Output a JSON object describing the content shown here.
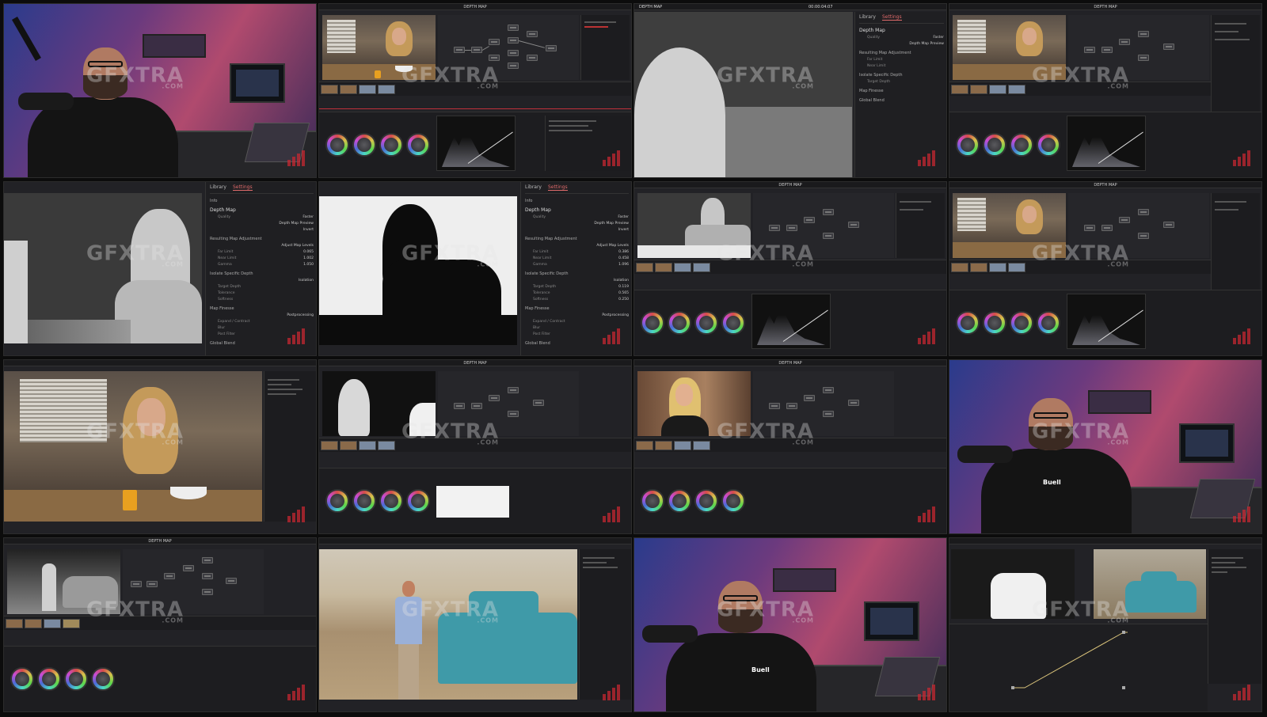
{
  "watermark": {
    "main": "GFXTRA",
    "sub": ".COM"
  },
  "tiles": [
    {
      "kind": "webcam"
    },
    {
      "kind": "resolve",
      "shot": "kitchen",
      "title": "DEPTH MAP"
    },
    {
      "kind": "depth-settings",
      "title": "DEPTH MAP",
      "timecode": "00:00:04:07",
      "tabs": [
        "Library",
        "Settings"
      ]
    },
    {
      "kind": "resolve",
      "shot": "kitchen",
      "title": "DEPTH MAP"
    },
    {
      "kind": "depth-settings-full",
      "shot": "depth-gray"
    },
    {
      "kind": "depth-settings-full",
      "shot": "depth-mask"
    },
    {
      "kind": "resolve",
      "shot": "depth-gray-small",
      "title": "DEPTH MAP"
    },
    {
      "kind": "resolve",
      "shot": "kitchen",
      "title": "DEPTH MAP"
    },
    {
      "kind": "big-viewer",
      "shot": "kitchen-large"
    },
    {
      "kind": "resolve",
      "shot": "depth-mask-small",
      "title": "DEPTH MAP"
    },
    {
      "kind": "resolve",
      "shot": "blonde",
      "title": "DEPTH MAP"
    },
    {
      "kind": "webcam"
    },
    {
      "kind": "resolve",
      "shot": "car-depth",
      "title": "DEPTH MAP"
    },
    {
      "kind": "big-viewer",
      "shot": "desert"
    },
    {
      "kind": "webcam"
    },
    {
      "kind": "fusion",
      "shot": "car-dual"
    }
  ],
  "settings": {
    "tabs": [
      "Library",
      "Settings"
    ],
    "section_label": "Info",
    "title": "Depth Map",
    "quality_label": "Quality",
    "quality_value": "Faster",
    "preview_label": "Depth Map Preview",
    "invert_label": "Invert",
    "adj_section": "Resulting Map Adjustment",
    "adjust_label": "Adjust Map Levels",
    "far_label": "Far Limit",
    "near_label": "Near Limit",
    "gamma_label": "Gamma",
    "isolate_section": "Isolate Specific Depth",
    "isolation_label": "Isolation",
    "target_label": "Target Depth",
    "tolerance_label": "Tolerance",
    "softness_label": "Softness",
    "finesse_section": "Map Finesse",
    "post_label": "Postprocessing",
    "expand_label": "Expand / Contract",
    "blur_label": "Blur",
    "postfilter_label": "Post Filter",
    "global_section": "Global Blend",
    "values_a": {
      "far": "0.065",
      "near": "1.002",
      "gamma": "1.050"
    },
    "values_b": {
      "far": "0.386",
      "near": "0.458",
      "gamma": "1.096",
      "target": "0.119",
      "tolerance": "0.565",
      "softness": "0.250"
    }
  },
  "webcam": {
    "shirt_logo": "Buell"
  },
  "colors": {
    "accent": "#e06a6a",
    "panel": "#1f1f22",
    "bg": "#0c0c0c"
  }
}
